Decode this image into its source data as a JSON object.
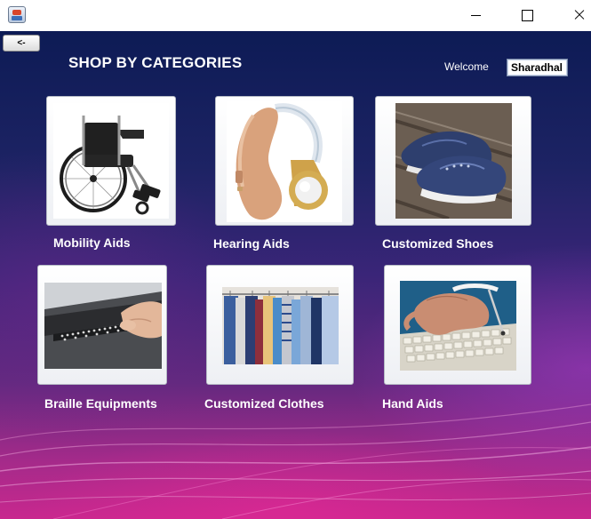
{
  "window": {
    "icon": "java-cup-icon",
    "controls": [
      "minimize-icon",
      "maximize-icon",
      "close-icon"
    ]
  },
  "nav": {
    "back_label": "<-"
  },
  "header": {
    "title": "SHOP BY CATEGORIES",
    "welcome_label": "Welcome",
    "username": "Sharadhal"
  },
  "categories": [
    {
      "label": "Mobility Aids",
      "image": "wheelchair-image"
    },
    {
      "label": "Hearing Aids",
      "image": "hearing-aid-image"
    },
    {
      "label": "Customized Shoes",
      "image": "shoes-image"
    },
    {
      "label": "Braille Equipments",
      "image": "braille-display-image"
    },
    {
      "label": "Customized Clothes",
      "image": "clothes-rack-image"
    },
    {
      "label": "Hand Aids",
      "image": "typing-aid-image"
    }
  ]
}
